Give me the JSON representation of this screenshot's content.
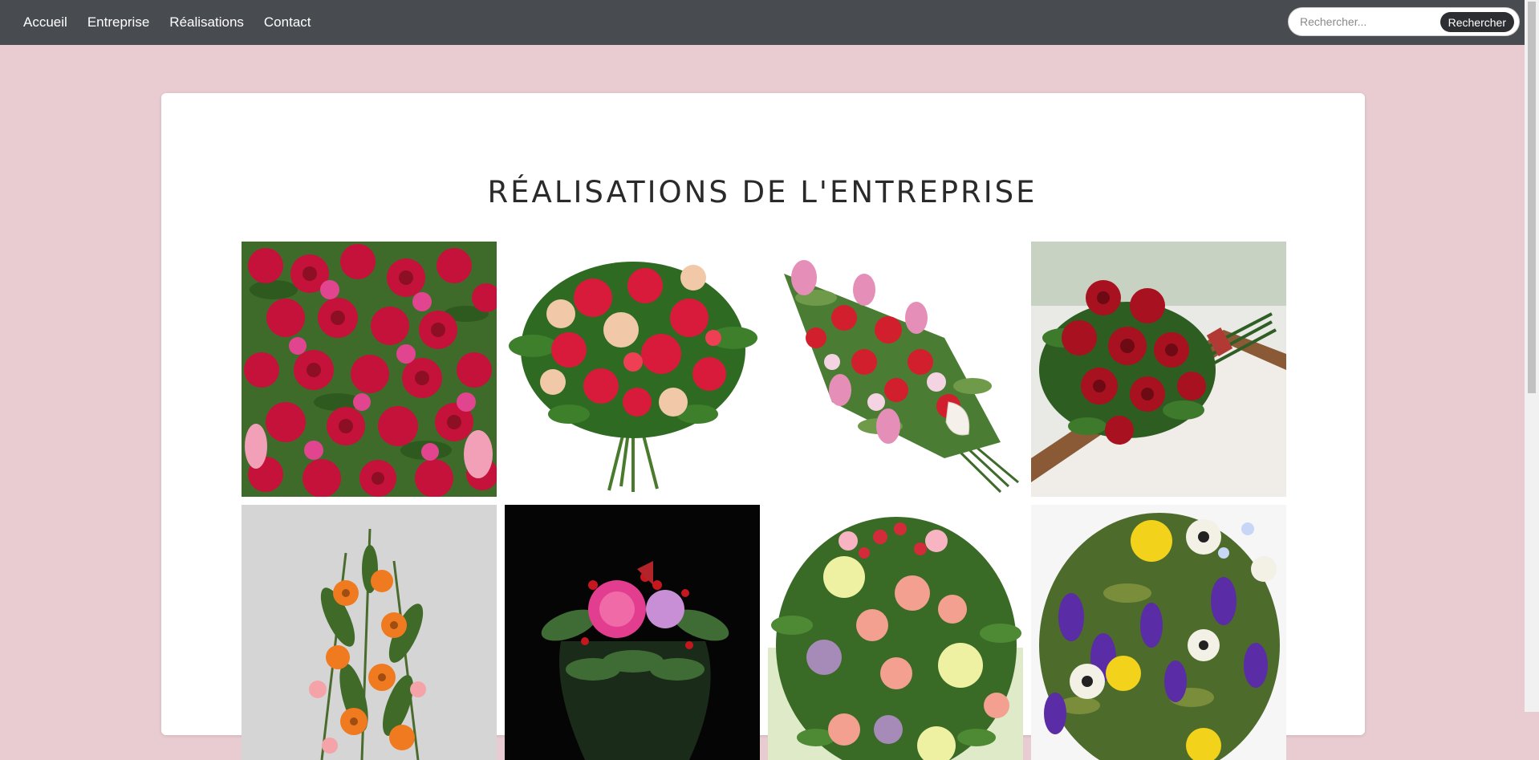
{
  "nav": {
    "links": [
      "Accueil",
      "Entreprise",
      "Réalisations",
      "Contact"
    ],
    "search_placeholder": "Rechercher...",
    "search_button": "Rechercher"
  },
  "main": {
    "title": "RÉALISATIONS DE L'ENTREPRISE"
  },
  "colors": {
    "page_background": "#e8ccd1",
    "navbar": "#484b50",
    "card": "#ffffff"
  },
  "gallery": {
    "photos": [
      "pink-red-roses-bouquet",
      "red-peach-rose-bouquet",
      "lily-carnation-spray",
      "long-stem-red-roses",
      "orange-gerbera-arrangement",
      "pink-peony-vase",
      "yellow-pink-rose-bouquet",
      "purple-iris-yellow-rose-bouquet"
    ]
  }
}
